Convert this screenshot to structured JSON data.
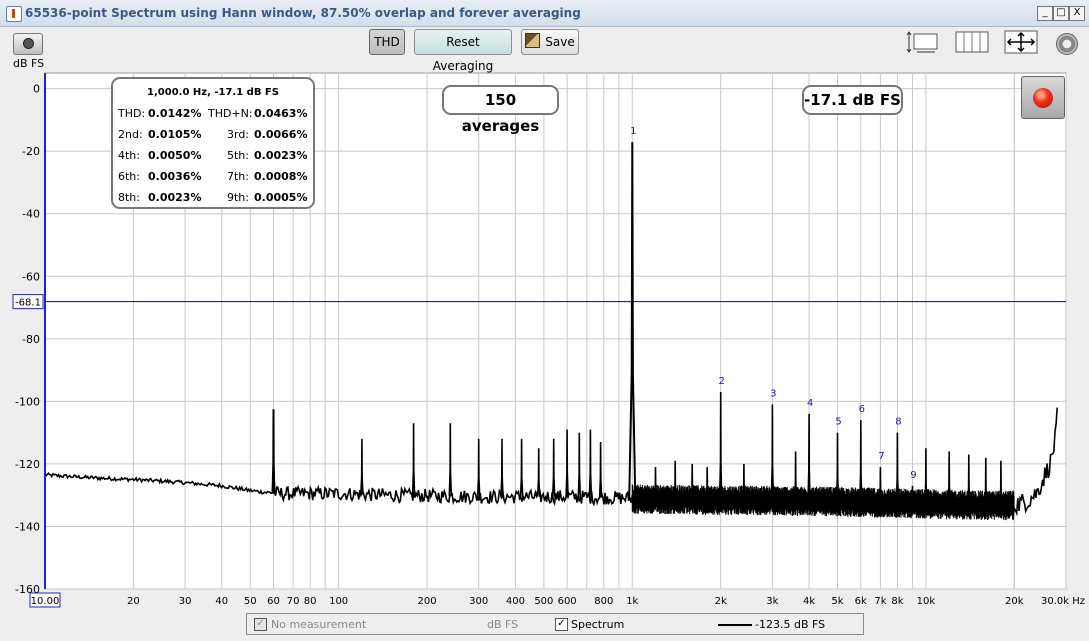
{
  "window": {
    "title": "65536-point Spectrum using Hann window, 87.50% overlap and forever averaging",
    "min_label": "_",
    "max_label": "□",
    "close_label": "X"
  },
  "toolbar": {
    "thd_label": "THD",
    "reset_label": "Reset Averaging",
    "save_label": "Save"
  },
  "axis_unit": "dB FS",
  "info": {
    "header": "1,000.0 Hz, -17.1 dB FS",
    "rows": [
      {
        "l1": "THD:",
        "v1": "0.0142%",
        "l2": "THD+N:",
        "v2": "0.0463%"
      },
      {
        "l1": "2nd:",
        "v1": "0.0105%",
        "l2": "3rd:",
        "v2": "0.0066%"
      },
      {
        "l1": "4th:",
        "v1": "0.0050%",
        "l2": "5th:",
        "v2": "0.0023%"
      },
      {
        "l1": "6th:",
        "v1": "0.0036%",
        "l2": "7th:",
        "v2": "0.0008%"
      },
      {
        "l1": "8th:",
        "v1": "0.0023%",
        "l2": "9th:",
        "v2": "0.0005%"
      }
    ]
  },
  "averages_label": "150 averages",
  "level_label": "-17.1 dB FS",
  "legend": {
    "no_measurement": "No measurement",
    "no_measurement_unit": "dB FS",
    "spectrum": "Spectrum",
    "spectrum_value": "-123.5 dB FS",
    "check_mark": "✓"
  },
  "colors": {
    "trace": "#000000",
    "grid": "#c8c8c8",
    "marker_line": "#0000a0",
    "harmonic_label": "#1a1aa0",
    "plot_bg": "#ffffff"
  },
  "chart_data": {
    "type": "line",
    "xscale": "log",
    "xlim": [
      10,
      30000
    ],
    "ylim": [
      -160,
      5
    ],
    "ylabel": "dB FS",
    "x_unit": "Hz",
    "x_ticks": [
      {
        "v": 10,
        "label": "10.00"
      },
      {
        "v": 20,
        "label": "20"
      },
      {
        "v": 30,
        "label": "30"
      },
      {
        "v": 40,
        "label": "40"
      },
      {
        "v": 50,
        "label": "50"
      },
      {
        "v": 60,
        "label": "60"
      },
      {
        "v": 70,
        "label": "70"
      },
      {
        "v": 80,
        "label": "80"
      },
      {
        "v": 100,
        "label": "100"
      },
      {
        "v": 200,
        "label": "200"
      },
      {
        "v": 300,
        "label": "300"
      },
      {
        "v": 400,
        "label": "400"
      },
      {
        "v": 500,
        "label": "500"
      },
      {
        "v": 600,
        "label": "600"
      },
      {
        "v": 800,
        "label": "800"
      },
      {
        "v": 1000,
        "label": "1k"
      },
      {
        "v": 2000,
        "label": "2k"
      },
      {
        "v": 3000,
        "label": "3k"
      },
      {
        "v": 4000,
        "label": "4k"
      },
      {
        "v": 5000,
        "label": "5k"
      },
      {
        "v": 6000,
        "label": "6k"
      },
      {
        "v": 7000,
        "label": "7k"
      },
      {
        "v": 8000,
        "label": "8k"
      },
      {
        "v": 10000,
        "label": "10k"
      },
      {
        "v": 20000,
        "label": "20k"
      },
      {
        "v": 30000,
        "label": "30.0k Hz"
      }
    ],
    "y_ticks": [
      0,
      -20,
      -40,
      -60,
      -80,
      -100,
      -120,
      -140,
      -160
    ],
    "marker_level": {
      "value": -68.1,
      "label": "-68.1"
    },
    "noise_floor": [
      [
        10,
        -123.5
      ],
      [
        12,
        -124
      ],
      [
        15,
        -124.5
      ],
      [
        20,
        -125
      ],
      [
        25,
        -125.5
      ],
      [
        30,
        -126
      ],
      [
        40,
        -127
      ],
      [
        50,
        -128.5
      ],
      [
        55,
        -129
      ],
      [
        65,
        -129.5
      ],
      [
        100,
        -129.5
      ],
      [
        150,
        -130
      ],
      [
        300,
        -130.5
      ],
      [
        600,
        -130.5
      ],
      [
        1000,
        -131
      ],
      [
        3000,
        -131.5
      ],
      [
        6000,
        -132
      ],
      [
        10000,
        -132.5
      ],
      [
        15000,
        -133
      ],
      [
        20000,
        -133
      ],
      [
        22000,
        -132
      ],
      [
        24000,
        -129
      ],
      [
        25000,
        -125
      ],
      [
        26500,
        -120
      ],
      [
        27500,
        -113
      ],
      [
        28000,
        -105
      ]
    ],
    "peaks": [
      [
        60,
        -102.5
      ],
      [
        120,
        -112
      ],
      [
        180,
        -107
      ],
      [
        240,
        -107
      ],
      [
        300,
        -112
      ],
      [
        360,
        -112
      ],
      [
        420,
        -112
      ],
      [
        480,
        -115
      ],
      [
        540,
        -112
      ],
      [
        600,
        -109
      ],
      [
        660,
        -110
      ],
      [
        720,
        -109
      ],
      [
        780,
        -113
      ],
      [
        1000,
        -17.1
      ],
      [
        1200,
        -121
      ],
      [
        1400,
        -119
      ],
      [
        1600,
        -120
      ],
      [
        1800,
        -121
      ],
      [
        2000,
        -97
      ],
      [
        2400,
        -120
      ],
      [
        3000,
        -101
      ],
      [
        3600,
        -116
      ],
      [
        4000,
        -104
      ],
      [
        5000,
        -110
      ],
      [
        6000,
        -106
      ],
      [
        7000,
        -121
      ],
      [
        8000,
        -110
      ],
      [
        9000,
        -127
      ],
      [
        10000,
        -115
      ],
      [
        12000,
        -116
      ],
      [
        14000,
        -117
      ],
      [
        16000,
        -118
      ],
      [
        18000,
        -119
      ]
    ],
    "harmonic_labels": [
      {
        "x": 1000,
        "y": -17.1,
        "label": "1"
      },
      {
        "x": 2000,
        "y": -97,
        "label": "2"
      },
      {
        "x": 3000,
        "y": -101,
        "label": "3"
      },
      {
        "x": 4000,
        "y": -104,
        "label": "4"
      },
      {
        "x": 5000,
        "y": -110,
        "label": "5"
      },
      {
        "x": 6000,
        "y": -106,
        "label": "6"
      },
      {
        "x": 7000,
        "y": -121,
        "label": "7"
      },
      {
        "x": 8000,
        "y": -110,
        "label": "8"
      },
      {
        "x": 9000,
        "y": -127,
        "label": "9"
      }
    ]
  }
}
